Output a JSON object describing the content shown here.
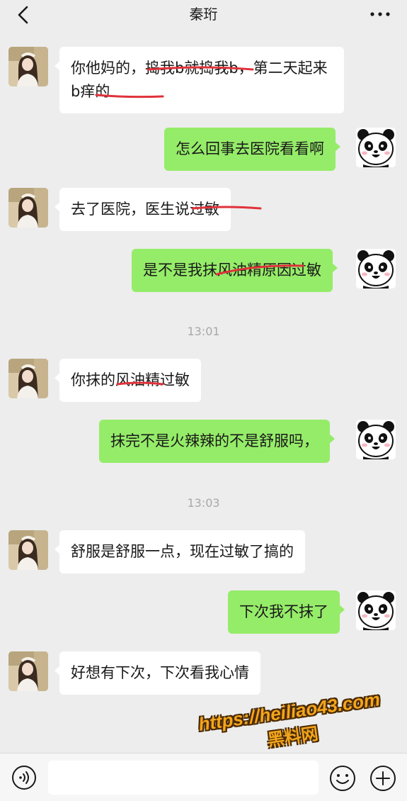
{
  "header": {
    "title": "秦珩"
  },
  "messages": [
    {
      "side": "in",
      "text": "你他妈的，捣我b就捣我b，第二天起来b痒的"
    },
    {
      "side": "out",
      "text": "怎么回事去医院看看啊"
    },
    {
      "side": "in",
      "text": "去了医院，医生说过敏"
    },
    {
      "side": "out",
      "text": "是不是我抹风油精原因过敏"
    },
    {
      "side": "in",
      "text": "你抹的风油精过敏"
    },
    {
      "side": "out",
      "text": "抹完不是火辣辣的不是舒服吗，"
    },
    {
      "side": "in",
      "text": "舒服是舒服一点，现在过敏了搞的"
    },
    {
      "side": "out",
      "text": "下次我不抹了"
    },
    {
      "side": "in",
      "text": "好想有下次，下次看我心情"
    }
  ],
  "timestamps": [
    "13:01",
    "13:03"
  ],
  "input": {
    "value": "",
    "placeholder": ""
  },
  "icons": {
    "back": "chevron-left-icon",
    "more": "more-dots-icon",
    "voice": "voice-icon",
    "emoji": "emoji-icon",
    "plus": "plus-icon"
  },
  "colors": {
    "background": "#ededed",
    "incoming_bubble": "#ffffff",
    "outgoing_bubble": "#95ec69",
    "redline": "#e0323a",
    "watermark": "#f3a51d"
  },
  "watermark": {
    "url": "https://heiliao43.com",
    "name": "黑料网"
  }
}
